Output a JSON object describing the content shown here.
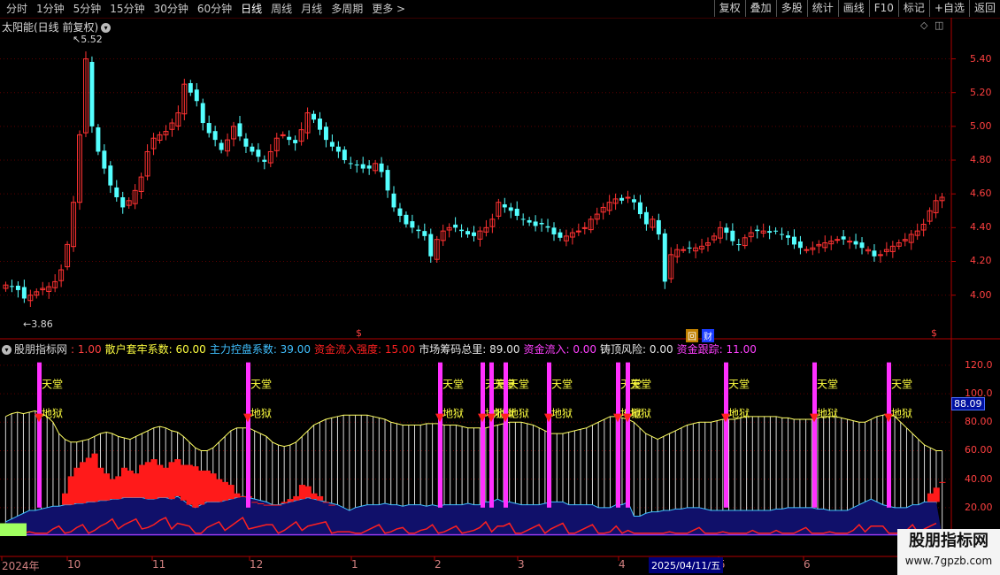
{
  "toolbar": {
    "left": [
      "分时",
      "1分钟",
      "5分钟",
      "15分钟",
      "30分钟",
      "60分钟",
      "日线",
      "周线",
      "月线",
      "多周期",
      "更多 >"
    ],
    "active": "日线",
    "right": [
      "复权",
      "叠加",
      "多股",
      "统计",
      "画线",
      "F10",
      "标记",
      "+自选",
      "返回"
    ]
  },
  "main": {
    "title": "太阳能(日线 前复权)",
    "price_ticks": [
      "5.40",
      "5.20",
      "5.00",
      "4.80",
      "4.60",
      "4.40",
      "4.20",
      "4.00"
    ],
    "high_label": "5.52",
    "low_label": "3.86",
    "marks": {
      "dollar1": "$",
      "dollar2": "$",
      "box": "回",
      "cai": "财"
    }
  },
  "indicator": {
    "name": "股朋指标网",
    "items": [
      {
        "label": ": 1.00",
        "color": "#ff4040"
      },
      {
        "label": "散户套牢系数: 60.00",
        "color": "#ffff40"
      },
      {
        "label": "主力控盘系数: 39.00",
        "color": "#40c0ff"
      },
      {
        "label": "资金流入强度: 15.00",
        "color": "#ff2020"
      },
      {
        "label": "市场筹码总里: 89.00",
        "color": "#e8e8e8"
      },
      {
        "label": "资金流入: 0.00",
        "color": "#ff40ff"
      },
      {
        "label": "铸顶风险: 0.00",
        "color": "#e8e8e8"
      },
      {
        "label": "资金跟踪: 11.00",
        "color": "#ff40ff"
      }
    ],
    "y_ticks": [
      "120.0",
      "100.0",
      "80.00",
      "60.00",
      "40.00",
      "20.00"
    ],
    "value_tag": "88.09",
    "signal_top": "天堂",
    "signal_bottom": "地狱"
  },
  "dates": {
    "labels": [
      "2024年",
      "10",
      "11",
      "12",
      "1",
      "2",
      "3",
      "4",
      "2025/04/11/五",
      "5",
      "6"
    ],
    "cursor": "2025/04/11/五"
  },
  "watermark": {
    "title": "股朋指标网",
    "url": "www.7gpzb.com"
  },
  "colors": {
    "up": "#ff3232",
    "down": "#54ffff",
    "axis": "#ff3333",
    "grid": "#700000"
  },
  "chart_data": {
    "type": "candlestick",
    "y_range": [
      3.86,
      5.52
    ],
    "close": [
      4.06,
      4.05,
      4.03,
      3.98,
      4.0,
      4.02,
      4.04,
      4.05,
      4.08,
      4.15,
      4.3,
      4.55,
      4.95,
      5.4,
      5.0,
      4.85,
      4.75,
      4.65,
      4.58,
      4.52,
      4.56,
      4.62,
      4.7,
      4.85,
      4.93,
      4.95,
      4.97,
      5.02,
      5.08,
      5.25,
      5.2,
      5.15,
      5.02,
      4.96,
      4.92,
      4.86,
      4.92,
      5.0,
      4.94,
      4.88,
      4.85,
      4.82,
      4.79,
      4.85,
      4.93,
      4.95,
      4.92,
      4.9,
      4.98,
      5.08,
      5.04,
      4.98,
      4.92,
      4.88,
      4.85,
      4.8,
      4.78,
      4.77,
      4.75,
      4.75,
      4.78,
      4.73,
      4.62,
      4.52,
      4.47,
      4.42,
      4.4,
      4.38,
      4.35,
      4.23,
      4.33,
      4.38,
      4.4,
      4.4,
      4.38,
      4.36,
      4.35,
      4.38,
      4.4,
      4.45,
      4.55,
      4.52,
      4.5,
      4.47,
      4.45,
      4.43,
      4.41,
      4.42,
      4.4,
      4.36,
      4.34,
      4.35,
      4.37,
      4.38,
      4.4,
      4.45,
      4.48,
      4.52,
      4.55,
      4.57,
      4.56,
      4.58,
      4.55,
      4.48,
      4.42,
      4.45,
      4.36,
      4.08,
      4.24,
      4.27,
      4.27,
      4.28,
      4.28,
      4.29,
      4.31,
      4.35,
      4.4,
      4.37,
      4.32,
      4.3,
      4.34,
      4.37,
      4.38,
      4.38,
      4.37,
      4.38,
      4.36,
      4.34,
      4.3,
      4.28,
      4.27,
      4.28,
      4.3,
      4.31,
      4.32,
      4.33,
      4.33,
      4.32,
      4.3,
      4.28,
      4.27,
      4.23,
      4.24,
      4.27,
      4.29,
      4.31,
      4.33,
      4.36,
      4.38,
      4.42,
      4.5,
      4.56,
      4.58
    ]
  },
  "indicator_data": {
    "white_bars_top": [
      84,
      86,
      87,
      86,
      87,
      88,
      86,
      84,
      80,
      72,
      68,
      66,
      66,
      67,
      68,
      70,
      72,
      73,
      72,
      70,
      69,
      68,
      70,
      72,
      74,
      76,
      77,
      76,
      74,
      73,
      70,
      66,
      62,
      60,
      60,
      62,
      66,
      70,
      74,
      76,
      76,
      76,
      74,
      72,
      70,
      66,
      64,
      63,
      64,
      66,
      70,
      74,
      78,
      80,
      82,
      83,
      84,
      85,
      85,
      85,
      85,
      85,
      84,
      83,
      82,
      80,
      79,
      78,
      78,
      78,
      78,
      79,
      79,
      79,
      78,
      78,
      78,
      77,
      76,
      76,
      76,
      76,
      77,
      78,
      79,
      80,
      80,
      80,
      79,
      78,
      76,
      74,
      72,
      72,
      72,
      73,
      74,
      75,
      76,
      78,
      80,
      82,
      84,
      84,
      83,
      82,
      80,
      76,
      72,
      70,
      68,
      70,
      72,
      74,
      76,
      78,
      79,
      80,
      80,
      80,
      81,
      82,
      82,
      82,
      83,
      84,
      84,
      84,
      84,
      84,
      84,
      83,
      83,
      82,
      82,
      82,
      82,
      83,
      84,
      84,
      84,
      83,
      82,
      81,
      80,
      80,
      82,
      84,
      85,
      86,
      84,
      80,
      76,
      72,
      68,
      64,
      62,
      60,
      60
    ],
    "red_area_top": [
      0,
      0,
      0,
      0,
      0,
      0,
      0,
      0,
      0,
      0,
      30,
      42,
      48,
      52,
      55,
      58,
      48,
      44,
      40,
      42,
      48,
      46,
      44,
      50,
      52,
      54,
      50,
      48,
      52,
      54,
      50,
      50,
      49,
      46,
      46,
      44,
      40,
      38,
      36,
      30,
      28,
      28,
      24,
      23,
      22,
      22,
      22,
      24,
      26,
      28,
      36,
      35,
      30,
      28,
      24,
      22,
      0,
      0,
      0,
      0,
      0,
      0,
      0,
      0,
      0,
      0,
      0,
      0,
      0,
      0,
      0,
      0,
      0,
      0,
      0,
      0,
      0,
      0,
      0,
      0,
      0,
      0,
      0,
      0,
      0,
      0,
      0,
      0,
      0,
      0,
      0,
      0,
      0,
      0,
      0,
      0,
      0,
      0,
      0,
      0,
      0,
      0,
      0,
      0,
      0,
      0,
      0,
      0,
      0,
      0,
      0,
      0,
      0,
      0,
      0,
      0,
      0,
      0,
      0,
      0,
      0,
      0,
      0,
      0,
      0,
      0,
      0,
      0,
      0,
      0,
      0,
      0,
      0,
      0,
      0,
      0,
      0,
      0,
      0,
      0,
      0,
      0,
      0,
      0,
      0,
      0,
      0,
      0,
      0,
      0,
      0,
      0,
      0,
      0,
      0,
      0,
      30,
      34,
      38,
      39
    ],
    "blue_line": [
      10,
      12,
      14,
      16,
      18,
      18,
      19,
      20,
      21,
      21,
      22,
      22,
      23,
      23,
      24,
      24,
      25,
      25,
      26,
      26,
      27,
      27,
      27,
      27,
      26,
      26,
      27,
      27,
      26,
      28,
      25,
      22,
      20,
      22,
      24,
      24,
      24,
      25,
      26,
      27,
      28,
      27,
      26,
      25,
      24,
      22,
      22,
      23,
      24,
      25,
      26,
      27,
      26,
      25,
      24,
      23,
      22,
      20,
      18,
      20,
      21,
      22,
      22,
      22,
      23,
      22,
      22,
      21,
      22,
      22,
      22,
      21,
      22,
      21,
      22,
      22,
      22,
      22,
      23,
      22,
      22,
      24,
      24,
      26,
      24,
      24,
      23,
      22,
      22,
      22,
      22,
      23,
      24,
      24,
      24,
      22,
      22,
      22,
      22,
      22,
      20,
      20,
      20,
      22,
      22,
      24,
      14,
      14,
      16,
      17,
      17,
      18,
      18,
      19,
      19,
      20,
      20,
      20,
      19,
      18,
      18,
      18,
      18,
      18,
      18,
      18,
      18,
      18,
      18,
      18,
      19,
      19,
      20,
      20,
      20,
      20,
      20,
      19,
      19,
      18,
      18,
      18,
      18,
      20,
      22,
      24,
      26,
      24,
      22,
      21,
      20,
      20,
      20,
      22,
      22,
      24,
      24,
      24
    ],
    "signal_idx": [
      8,
      56,
      101,
      110,
      113,
      116,
      126,
      141,
      144,
      165,
      185,
      202
    ]
  }
}
